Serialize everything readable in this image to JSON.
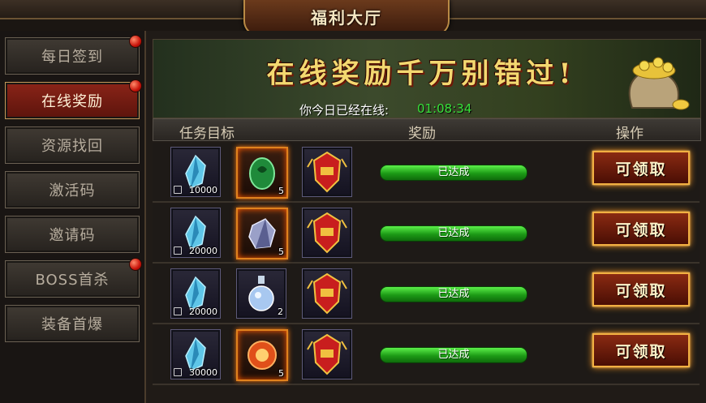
{
  "window": {
    "title": "福利大厅"
  },
  "sidebar": {
    "items": [
      {
        "label": "每日签到",
        "active": false,
        "badge": true
      },
      {
        "label": "在线奖励",
        "active": true,
        "badge": true
      },
      {
        "label": "资源找回",
        "active": false,
        "badge": false
      },
      {
        "label": "激活码",
        "active": false,
        "badge": false
      },
      {
        "label": "邀请码",
        "active": false,
        "badge": false
      },
      {
        "label": "BOSS首杀",
        "active": false,
        "badge": true
      },
      {
        "label": "装备首爆",
        "active": false,
        "badge": false
      }
    ]
  },
  "banner": {
    "title": "在线奖励千万别错过!",
    "online_label": "你今日已经在线:",
    "online_time": "01:08:34"
  },
  "table": {
    "headers": {
      "target": "任务目标",
      "reward": "奖励",
      "action": "操作"
    },
    "rows": [
      {
        "items": [
          {
            "icon": "crystal-icon",
            "count": "10000",
            "locked": true
          },
          {
            "icon": "jade-egg-icon",
            "count": "5",
            "rare": true
          },
          {
            "icon": "medal-icon",
            "count": ""
          }
        ],
        "status": "已达成",
        "action": "可领取"
      },
      {
        "items": [
          {
            "icon": "crystal-icon",
            "count": "20000",
            "locked": true
          },
          {
            "icon": "ore-icon",
            "count": "5",
            "rare": true
          },
          {
            "icon": "medal-icon",
            "count": ""
          }
        ],
        "status": "已达成",
        "action": "可领取"
      },
      {
        "items": [
          {
            "icon": "crystal-icon",
            "count": "20000",
            "locked": true
          },
          {
            "icon": "potion-icon",
            "count": "2",
            "rare": false
          },
          {
            "icon": "medal-icon",
            "count": ""
          }
        ],
        "status": "已达成",
        "action": "可领取"
      },
      {
        "items": [
          {
            "icon": "crystal-icon",
            "count": "30000",
            "locked": true
          },
          {
            "icon": "fire-orb-icon",
            "count": "5",
            "rare": true
          },
          {
            "icon": "medal-icon",
            "count": ""
          }
        ],
        "status": "已达成",
        "action": "可领取"
      }
    ]
  },
  "colors": {
    "accent": "#f2b042",
    "status_green": "#2cc026",
    "active_tab": "#8a2418"
  }
}
